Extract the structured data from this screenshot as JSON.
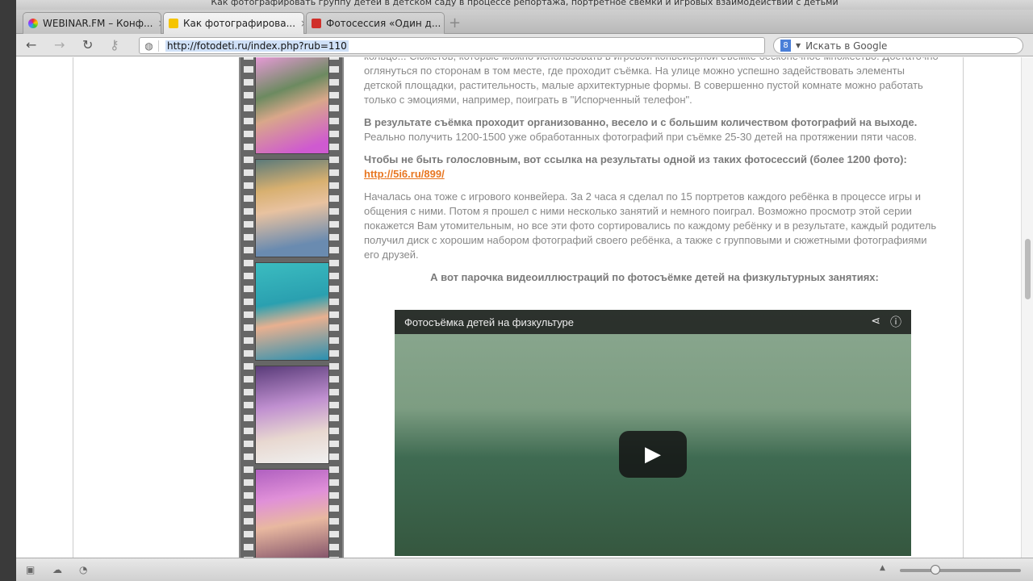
{
  "window": {
    "title": "Как фотографировать группу детей в детском саду в процессе репортажа, портретное свемки и игровых взаимодействий с детьми"
  },
  "tabs": [
    {
      "label": "WEBINAR.FM – Конф...",
      "color": "#7c3fd4"
    },
    {
      "label": "Как фотографирова...",
      "color": "#f5c400"
    },
    {
      "label": "Фотосессия «Один д...",
      "color": "#d0302a"
    }
  ],
  "toolbar": {
    "url": "http://fotodeti.ru/index.php?rub=110",
    "search_placeholder": "Искать в Google"
  },
  "article": {
    "p1": "кольцо... Сюжетов, которые можно использовать в игровой конвейерной съемке бесконечное множество. Достаточно оглянуться по сторонам в том месте, где проходит съёмка. На улице можно успешно задействовать элементы детской площадки, растительность, малые архитектурные формы. В совершенно пустой комнате можно работать только с эмоциями, например, поиграть в \"Испорченный телефон\".",
    "p2_bold": "В результате съёмка проходит организованно, весело и с большим количеством фотографий на выходе.",
    "p2": "Реально получить 1200-1500 уже обработанных фотографий при съёмке 25-30 детей на протяжении пяти часов.",
    "p3_bold": "Чтобы не быть голословным, вот ссылка на результаты одной из таких фотосессий (более 1200 фото):",
    "p3_link": "http://5i6.ru/899/",
    "p4": "Началась она тоже с игрового конвейера. За 2 часа я сделал по 15 портретов каждого ребёнка в процессе игры и общения с ними. Потом я прошел с ними несколько занятий и немного поиграл. Возможно просмотр этой серии покажется Вам утомительным, но все эти фото сортировались по каждому ребёнку и в результате, каждый родитель получил диск с хорошим набором фотографий своего ребёнка, а также с групповыми и сюжетными фотографиями его друзей.",
    "video_intro": "А вот парочка видеоиллюстраций по фотосъёмке детей на физкультурных занятиях:"
  },
  "video": {
    "title": "Фотосъёмка детей на физкультуре"
  }
}
